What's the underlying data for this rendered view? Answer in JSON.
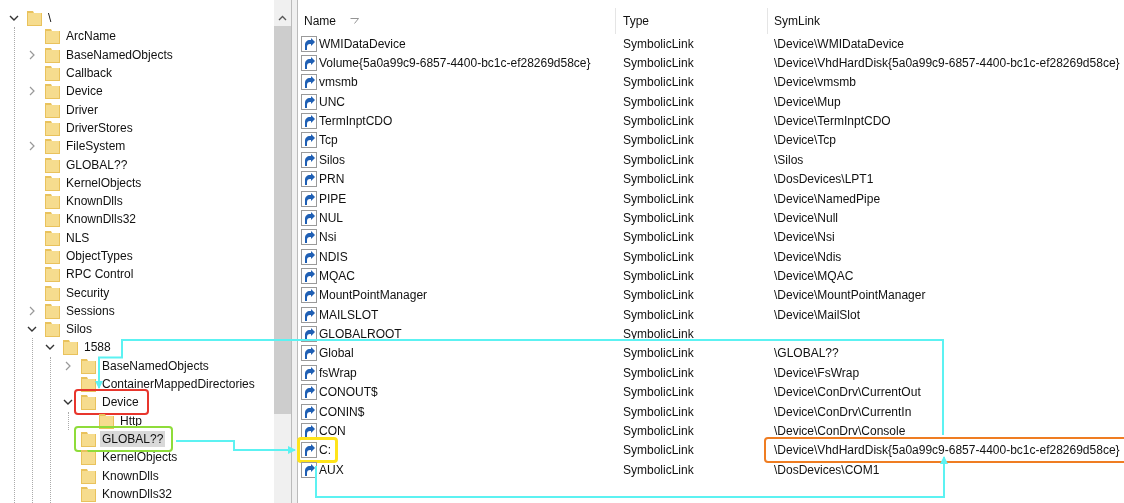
{
  "tree": {
    "nodes": [
      {
        "label": "\\",
        "expanded": true,
        "selected": false,
        "children": [
          {
            "label": "ArcName",
            "selected": false
          },
          {
            "label": "BaseNamedObjects",
            "expanded": false,
            "selected": false
          },
          {
            "label": "Callback",
            "selected": false
          },
          {
            "label": "Device",
            "expanded": false,
            "selected": false
          },
          {
            "label": "Driver",
            "selected": false
          },
          {
            "label": "DriverStores",
            "selected": false
          },
          {
            "label": "FileSystem",
            "expanded": false,
            "selected": false
          },
          {
            "label": "GLOBAL??",
            "selected": false
          },
          {
            "label": "KernelObjects",
            "selected": false
          },
          {
            "label": "KnownDlls",
            "selected": false
          },
          {
            "label": "KnownDlls32",
            "selected": false
          },
          {
            "label": "NLS",
            "selected": false
          },
          {
            "label": "ObjectTypes",
            "selected": false
          },
          {
            "label": "RPC Control",
            "selected": false
          },
          {
            "label": "Security",
            "selected": false
          },
          {
            "label": "Sessions",
            "expanded": false,
            "selected": false
          },
          {
            "label": "Silos",
            "expanded": true,
            "selected": false,
            "children": [
              {
                "label": "1588",
                "expanded": true,
                "selected": false,
                "children": [
                  {
                    "label": "BaseNamedObjects",
                    "expanded": false,
                    "selected": false
                  },
                  {
                    "label": "ContainerMappedDirectories",
                    "selected": false
                  },
                  {
                    "label": "Device",
                    "expanded": true,
                    "selected": false,
                    "color": "#e8352c",
                    "children": [
                      {
                        "label": "Http",
                        "selected": false
                      }
                    ]
                  },
                  {
                    "label": "GLOBAL??",
                    "selected": true,
                    "color": "#8edc3a"
                  },
                  {
                    "label": "KernelObjects",
                    "selected": false
                  },
                  {
                    "label": "KnownDlls",
                    "selected": false
                  },
                  {
                    "label": "KnownDlls32",
                    "selected": false
                  }
                ]
              }
            ]
          }
        ]
      }
    ]
  },
  "list": {
    "columns": [
      {
        "label": "Name",
        "sorted": true
      },
      {
        "label": "Type",
        "sorted": false
      },
      {
        "label": "SymLink",
        "sorted": false
      }
    ],
    "rows": [
      {
        "name": "WMIDataDevice",
        "type": "SymbolicLink",
        "symlink": "\\Device\\WMIDataDevice"
      },
      {
        "name": "Volume{5a0a99c9-6857-4400-bc1c-ef28269d58ce}",
        "type": "SymbolicLink",
        "symlink": "\\Device\\VhdHardDisk{5a0a99c9-6857-4400-bc1c-ef28269d58ce}"
      },
      {
        "name": "vmsmb",
        "type": "SymbolicLink",
        "symlink": "\\Device\\vmsmb"
      },
      {
        "name": "UNC",
        "type": "SymbolicLink",
        "symlink": "\\Device\\Mup"
      },
      {
        "name": "TermInptCDO",
        "type": "SymbolicLink",
        "symlink": "\\Device\\TermInptCDO"
      },
      {
        "name": "Tcp",
        "type": "SymbolicLink",
        "symlink": "\\Device\\Tcp"
      },
      {
        "name": "Silos",
        "type": "SymbolicLink",
        "symlink": "\\Silos"
      },
      {
        "name": "PRN",
        "type": "SymbolicLink",
        "symlink": "\\DosDevices\\LPT1"
      },
      {
        "name": "PIPE",
        "type": "SymbolicLink",
        "symlink": "\\Device\\NamedPipe"
      },
      {
        "name": "NUL",
        "type": "SymbolicLink",
        "symlink": "\\Device\\Null"
      },
      {
        "name": "Nsi",
        "type": "SymbolicLink",
        "symlink": "\\Device\\Nsi"
      },
      {
        "name": "NDIS",
        "type": "SymbolicLink",
        "symlink": "\\Device\\Ndis"
      },
      {
        "name": "MQAC",
        "type": "SymbolicLink",
        "symlink": "\\Device\\MQAC"
      },
      {
        "name": "MountPointManager",
        "type": "SymbolicLink",
        "symlink": "\\Device\\MountPointManager"
      },
      {
        "name": "MAILSLOT",
        "type": "SymbolicLink",
        "symlink": "\\Device\\MailSlot"
      },
      {
        "name": "GLOBALROOT",
        "type": "SymbolicLink"
      },
      {
        "name": "Global",
        "type": "SymbolicLink",
        "symlink": "\\GLOBAL??"
      },
      {
        "name": "fsWrap",
        "type": "SymbolicLink",
        "symlink": "\\Device\\FsWrap"
      },
      {
        "name": "CONOUT$",
        "type": "SymbolicLink",
        "symlink": "\\Device\\ConDrv\\CurrentOut"
      },
      {
        "name": "CONIN$",
        "type": "SymbolicLink",
        "symlink": "\\Device\\ConDrv\\CurrentIn"
      },
      {
        "name": "CON",
        "type": "SymbolicLink",
        "symlink": "\\Device\\ConDrv\\Console"
      },
      {
        "name": "C:",
        "type": "SymbolicLink",
        "symlink": "\\Device\\VhdHardDisk{5a0a99c9-6857-4400-bc1c-ef28269d58ce}",
        "name_frame": {
          "color": "#ffe41a"
        },
        "symlink_frame": {
          "color": "#ef7d22"
        }
      },
      {
        "name": "AUX",
        "type": "SymbolicLink",
        "symlink": "\\DosDevices\\COM1"
      }
    ]
  }
}
